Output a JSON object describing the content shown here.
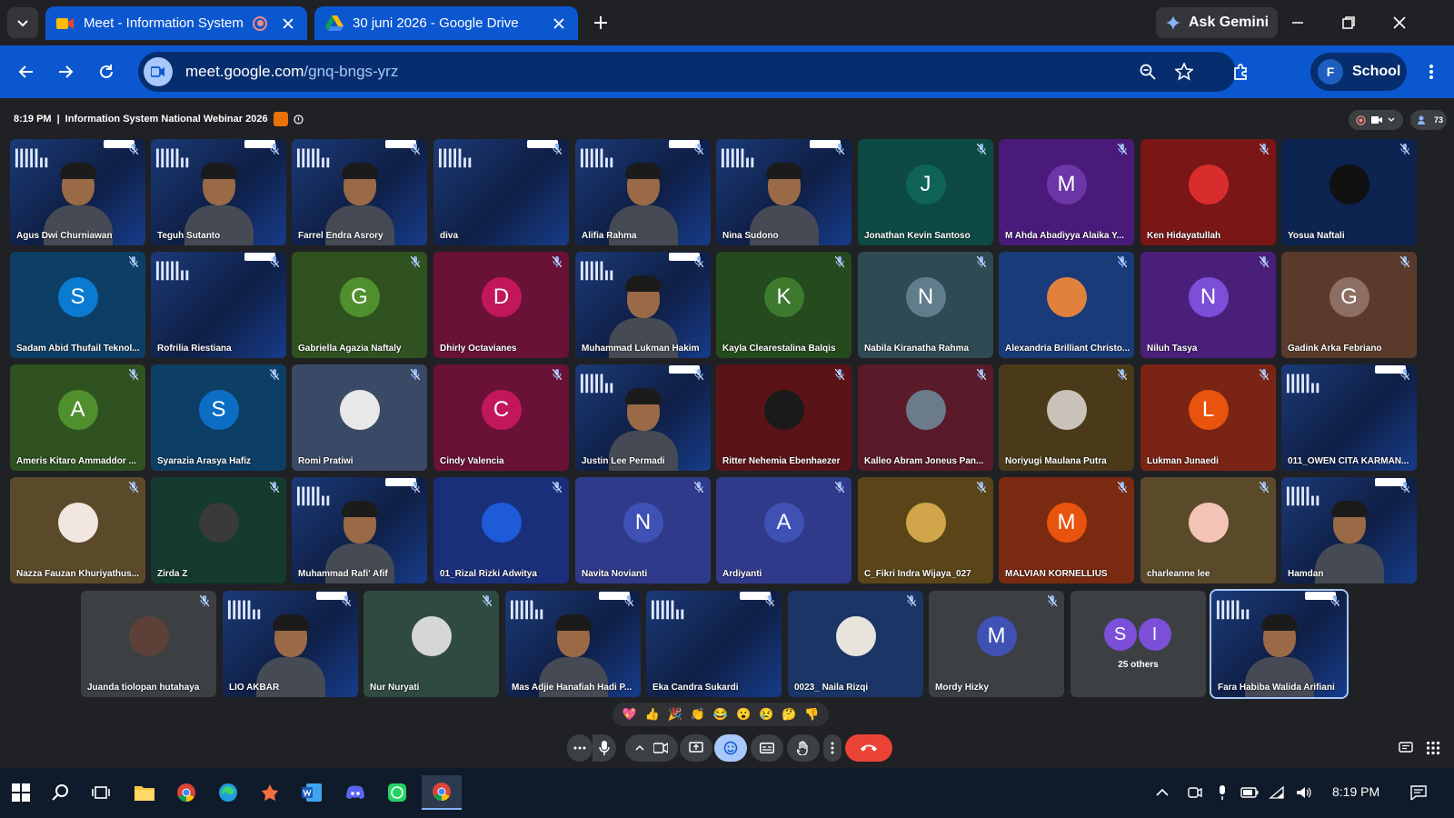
{
  "browser": {
    "tabs": [
      {
        "title": "Meet - Information System",
        "icon": "google-meet-icon"
      },
      {
        "title": "30 juni 2026 - Google Drive",
        "icon": "google-drive-icon"
      }
    ],
    "ask_gemini": "Ask Gemini",
    "url_host": "meet.google.com",
    "url_path": "/gnq-bngs-yrz",
    "profile_initial": "F",
    "profile_label": "School"
  },
  "meeting": {
    "time": "8:19 PM",
    "separator": "|",
    "title": "Information System National Webinar 2026",
    "participant_count": "73",
    "others_label": "25 others",
    "others_initials": [
      "S",
      "I"
    ]
  },
  "participants": [
    {
      "name": "Agus Dwi Churniawan",
      "kind": "video"
    },
    {
      "name": "Teguh Sutanto",
      "kind": "video"
    },
    {
      "name": "Farrel Endra Asrory",
      "kind": "video"
    },
    {
      "name": "diva",
      "kind": "banner"
    },
    {
      "name": "Alifia Rahma",
      "kind": "video"
    },
    {
      "name": "Nina Sudono",
      "kind": "video"
    },
    {
      "name": "Jonathan Kevin Santoso",
      "kind": "initial",
      "initial": "J",
      "bg": "#0d4a43",
      "avbg": "#0f6357"
    },
    {
      "name": "M Ahda Abadiyya Alaika Y...",
      "kind": "initial",
      "initial": "M",
      "bg": "#4a1a7a",
      "avbg": "#6a36a8"
    },
    {
      "name": "Ken Hidayatullah",
      "kind": "image",
      "bg": "#7a1616",
      "avbg": "#d92d2d"
    },
    {
      "name": "Yosua Naftali",
      "kind": "image",
      "bg": "#0d2350",
      "avbg": "#111111"
    },
    {
      "name": "Sadam Abid Thufail Teknol...",
      "kind": "initial",
      "initial": "S",
      "bg": "#0d3f66",
      "avbg": "#0b7ad1"
    },
    {
      "name": "Rofrilia Riestiana",
      "kind": "banner"
    },
    {
      "name": "Gabriella Agazia Naftaly",
      "kind": "initial",
      "initial": "G",
      "bg": "#2f5220",
      "avbg": "#4f8f2e"
    },
    {
      "name": "Dhirly Octavianes",
      "kind": "initial",
      "initial": "D",
      "bg": "#6a1236",
      "avbg": "#c2185b"
    },
    {
      "name": "Muhammad Lukman Hakim",
      "kind": "video"
    },
    {
      "name": "Kayla Clearestalina Balqis",
      "kind": "initial",
      "initial": "K",
      "bg": "#254a1d",
      "avbg": "#3d7a2d"
    },
    {
      "name": "Nabila Kiranatha Rahma",
      "kind": "initial",
      "initial": "N",
      "bg": "#2f4a52",
      "avbg": "#607d8b"
    },
    {
      "name": "Alexandria Brilliant Christo...",
      "kind": "image",
      "bg": "#1a3b7a",
      "avbg": "#e0823d"
    },
    {
      "name": "Niluh Tasya",
      "kind": "initial",
      "initial": "N",
      "bg": "#4a1f7a",
      "avbg": "#7b4fd8"
    },
    {
      "name": "Gadink Arka Febriano",
      "kind": "initial",
      "initial": "G",
      "bg": "#5a3a2a",
      "avbg": "#8d6e63"
    },
    {
      "name": "Ameris Kitaro Ammaddor ...",
      "kind": "initial",
      "initial": "A",
      "bg": "#2f5220",
      "avbg": "#4f8f2e"
    },
    {
      "name": "Syarazia Arasya Hafiz",
      "kind": "initial",
      "initial": "S",
      "bg": "#0d3f66",
      "avbg": "#0b6ec4"
    },
    {
      "name": "Romi Pratiwi",
      "kind": "image",
      "bg": "#3a4a66",
      "avbg": "#e8e8e8"
    },
    {
      "name": "Cindy Valencia",
      "kind": "initial",
      "initial": "C",
      "bg": "#6a1236",
      "avbg": "#c2185b"
    },
    {
      "name": "Justin Lee Permadi",
      "kind": "video"
    },
    {
      "name": "Ritter Nehemia Ebenhaezer",
      "kind": "image",
      "bg": "#5a1418",
      "avbg": "#1a1a1a"
    },
    {
      "name": "Kalleo Abram Joneus Pan...",
      "kind": "image",
      "bg": "#5a1a2a",
      "avbg": "#6b7b8a"
    },
    {
      "name": "Noriyugi Maulana Putra",
      "kind": "image",
      "bg": "#4a3a1a",
      "avbg": "#c9c2b8"
    },
    {
      "name": "Lukman Junaedi",
      "kind": "initial",
      "initial": "L",
      "bg": "#7a2416",
      "avbg": "#e8530e"
    },
    {
      "name": "011_OWEN CITA KARMAN...",
      "kind": "banner"
    },
    {
      "name": "Nazza Fauzan Khuriyathus...",
      "kind": "image",
      "bg": "#5a4a2a",
      "avbg": "#f1e6e0"
    },
    {
      "name": "Zirda Z",
      "kind": "image",
      "bg": "#143b2e",
      "avbg": "#3a3a3a"
    },
    {
      "name": "Muhammad Rafi' Afif",
      "kind": "video"
    },
    {
      "name": "01_Rizal Rizki Adwitya",
      "kind": "image",
      "bg": "#1a2f7a",
      "avbg": "#1e5bd6"
    },
    {
      "name": "Navita Novianti",
      "kind": "initial",
      "initial": "N",
      "bg": "#2f3a8a",
      "avbg": "#3f51b5"
    },
    {
      "name": "Ardiyanti",
      "kind": "initial",
      "initial": "A",
      "bg": "#2f3a8a",
      "avbg": "#3f51b5"
    },
    {
      "name": "C_Fikri Indra Wijaya_027",
      "kind": "image",
      "bg": "#5a4418",
      "avbg": "#d1a64a"
    },
    {
      "name": "MALVIAN KORNELLIUS",
      "kind": "initial",
      "initial": "M",
      "bg": "#7a2a10",
      "avbg": "#e8530e"
    },
    {
      "name": "charleanne lee",
      "kind": "image",
      "bg": "#5a4a2a",
      "avbg": "#f3c4b6"
    },
    {
      "name": "Hamdan",
      "kind": "video"
    }
  ],
  "bottom_row": [
    {
      "name": "Juanda tiolopan hutahaya",
      "kind": "image",
      "bg": "#3c4043",
      "avbg": "#5d4037"
    },
    {
      "name": "LIO AKBAR",
      "kind": "video"
    },
    {
      "name": "Nur Nuryati",
      "kind": "image",
      "bg": "#2f4a40",
      "avbg": "#d6d6d6"
    },
    {
      "name": "Mas Adjie Hanafiah Hadi P...",
      "kind": "video"
    },
    {
      "name": "Eka Candra Sukardi",
      "kind": "banner"
    },
    {
      "name": "0023_ Naila Rizqi",
      "kind": "image",
      "bg": "#1a3566",
      "avbg": "#e8e4dc"
    },
    {
      "name": "Mordy Hizky",
      "kind": "initial",
      "initial": "M",
      "bg": "#3c4043",
      "avbg": "#3f51b5"
    },
    {
      "name": "",
      "kind": "others"
    },
    {
      "name": "Fara Habiba Walida Arifiani",
      "kind": "video"
    }
  ],
  "reactions": [
    "💖",
    "👍",
    "🎉",
    "👏",
    "😂",
    "😮",
    "😢",
    "🤔",
    "👎"
  ],
  "taskbar": {
    "clock": "8:19 PM",
    "apps": [
      "windows-start-icon",
      "search-icon",
      "task-view-icon",
      "file-explorer-icon",
      "chrome-icon",
      "edge-icon",
      "app-icon",
      "word-icon",
      "discord-icon",
      "whatsapp-icon",
      "chrome-icon"
    ]
  },
  "colors": {
    "accent": "#0b57d0",
    "leave": "#ea4335",
    "meet_bg": "#202124"
  }
}
